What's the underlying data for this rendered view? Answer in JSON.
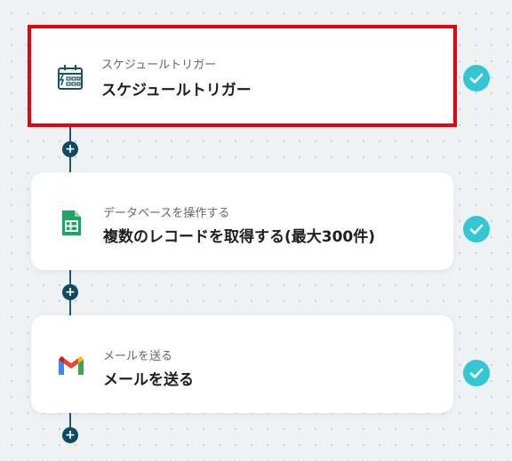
{
  "steps": [
    {
      "subtitle": "スケジュールトリガー",
      "title": "スケジュールトリガー",
      "icon": "schedule-calendar-icon",
      "status": "completed"
    },
    {
      "subtitle": "データベースを操作する",
      "title": "複数のレコードを取得する(最大300件)",
      "icon": "google-sheets-icon",
      "status": "completed"
    },
    {
      "subtitle": "メールを送る",
      "title": "メールを送る",
      "icon": "gmail-icon",
      "status": "completed"
    }
  ],
  "add_step_symbol": "+",
  "colors": {
    "selected_border": "#e8000b",
    "check_badge": "#34c6d4",
    "connector": "#23566a",
    "add_button": "#0f4a63"
  }
}
